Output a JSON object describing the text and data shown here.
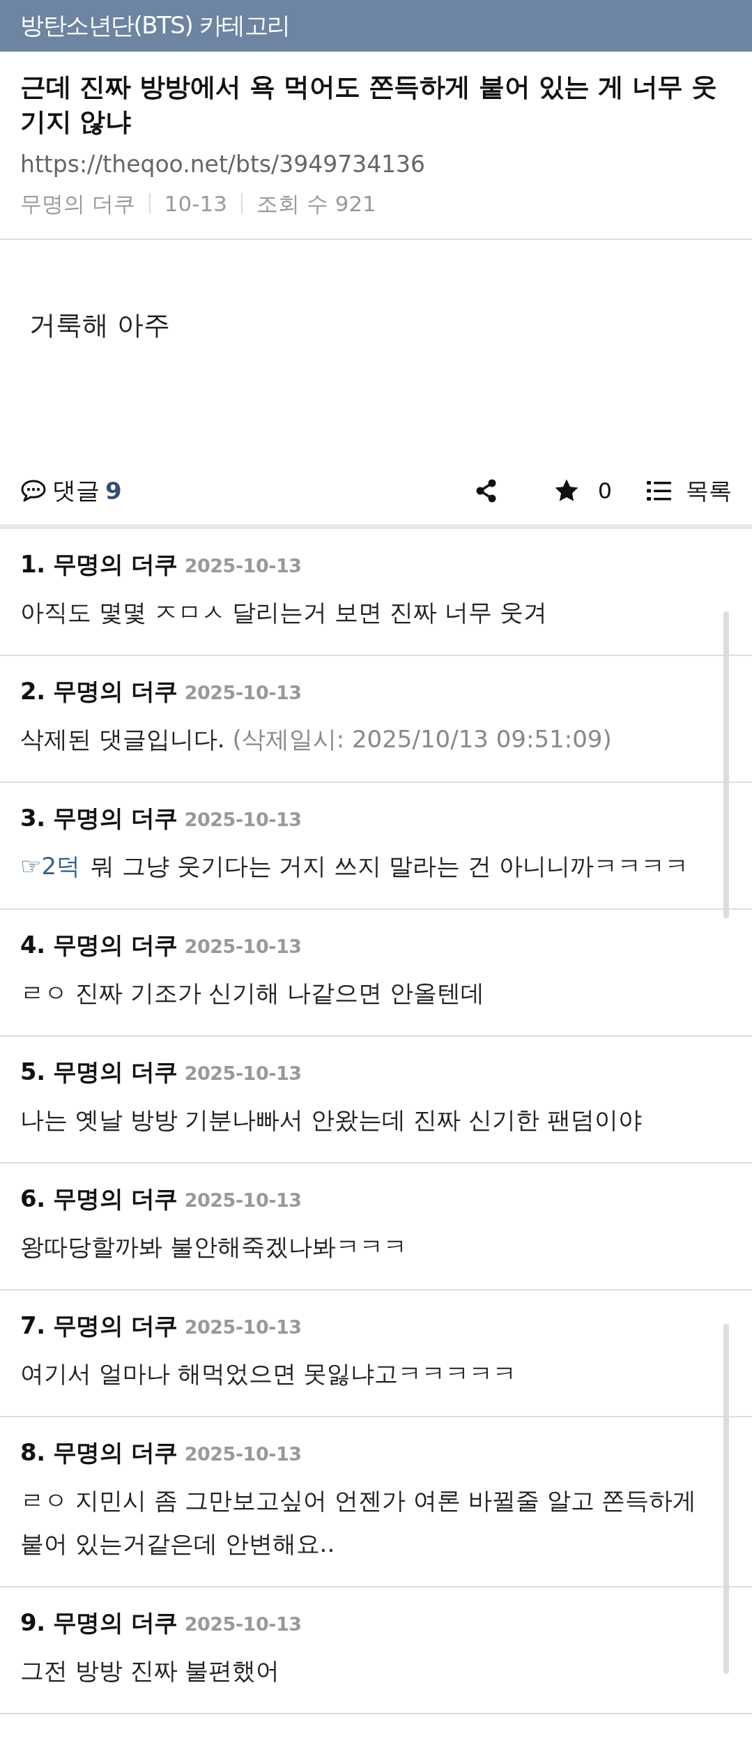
{
  "category_bar": {
    "title": "방탄소년단(BTS) 카테고리"
  },
  "post": {
    "title": "근데 진짜 방방에서 욕 먹어도 쫀득하게 붙어 있는 게 너무 웃기지 않냐",
    "url": "https://theqoo.net/bts/3949734136",
    "author": "무명의 더쿠",
    "date": "10-13",
    "views": "조회 수 921",
    "body": "거룩해 아주"
  },
  "action_bar": {
    "comments_label": "댓글",
    "comments_count": "9",
    "stars": "0",
    "list_label": "목록"
  },
  "comments": [
    {
      "kind": "normal",
      "number": "1.",
      "author": "무명의 더쿠",
      "date": "2025-10-13",
      "text": "아직도 몇몇 ㅈㅁㅅ 달리는거 보면 진짜 너무 웃겨"
    },
    {
      "kind": "deleted",
      "number": "2.",
      "author": "무명의 더쿠",
      "date": "2025-10-13",
      "text": "삭제된 댓글입니다.",
      "note": "(삭제일시: 2025/10/13 09:51:09)"
    },
    {
      "kind": "reply",
      "number": "3.",
      "author": "무명의 더쿠",
      "date": "2025-10-13",
      "mention": "☞2덕",
      "text": "뭐 그냥 웃기다는 거지 쓰지 말라는 건 아니니까ㅋㅋㅋㅋ"
    },
    {
      "kind": "normal",
      "number": "4.",
      "author": "무명의 더쿠",
      "date": "2025-10-13",
      "text": "ㄹㅇ 진짜 기조가 신기해 나같으면 안올텐데"
    },
    {
      "kind": "normal",
      "number": "5.",
      "author": "무명의 더쿠",
      "date": "2025-10-13",
      "text": "나는 옛날 방방 기분나빠서 안왔는데 진짜 신기한 팬덤이야"
    },
    {
      "kind": "normal",
      "number": "6.",
      "author": "무명의 더쿠",
      "date": "2025-10-13",
      "text": "왕따당할까봐 불안해죽겠나봐ㅋㅋㅋ"
    },
    {
      "kind": "normal",
      "number": "7.",
      "author": "무명의 더쿠",
      "date": "2025-10-13",
      "text": "여기서 얼마나 해먹었으면 못잃냐고ㅋㅋㅋㅋㅋ"
    },
    {
      "kind": "normal",
      "number": "8.",
      "author": "무명의 더쿠",
      "date": "2025-10-13",
      "text": "ㄹㅇ 지민시 좀 그만보고싶어 언젠가 여론 바뀔줄 알고 쫀득하게 붙어 있는거같은데 안변해요.."
    },
    {
      "kind": "normal",
      "number": "9.",
      "author": "무명의 더쿠",
      "date": "2025-10-13",
      "text": "그전 방방 진짜 불편했어"
    }
  ]
}
